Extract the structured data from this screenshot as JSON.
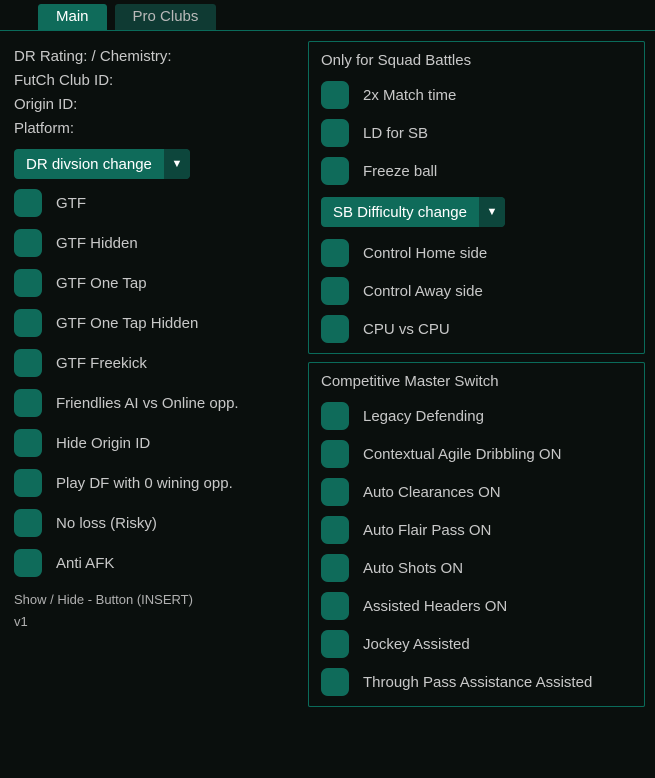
{
  "tabs": {
    "main": "Main",
    "proClubs": "Pro Clubs"
  },
  "info": {
    "drRating": "DR Rating:  / Chemistry:",
    "futchClubId": "FutCh Club ID:",
    "originId": "Origin ID:",
    "platform": "Platform:"
  },
  "dropdowns": {
    "drDivision": "DR divsion change",
    "sbDifficulty": "SB Difficulty change"
  },
  "leftChecks": [
    "GTF",
    "GTF Hidden",
    "GTF One Tap",
    "GTF One Tap Hidden",
    "GTF Freekick",
    "Friendlies AI vs Online opp.",
    "Hide Origin ID",
    "Play DF with 0 wining opp.",
    "No loss (Risky)",
    "Anti AFK"
  ],
  "footer": {
    "showHide": "Show / Hide - Button (INSERT)",
    "version": "v1"
  },
  "squadBattles": {
    "title": "Only for Squad Battles",
    "before": [
      "2x Match time",
      "LD for SB",
      "Freeze ball"
    ],
    "after": [
      "Control Home side",
      "Control Away side",
      "CPU vs CPU"
    ]
  },
  "masterSwitch": {
    "title": "Competitive Master Switch",
    "items": [
      "Legacy Defending",
      "Contextual Agile Dribbling ON",
      "Auto Clearances ON",
      "Auto Flair Pass ON",
      "Auto Shots ON",
      "Assisted Headers ON",
      "Jockey Assisted",
      "Through Pass Assistance Assisted"
    ]
  }
}
